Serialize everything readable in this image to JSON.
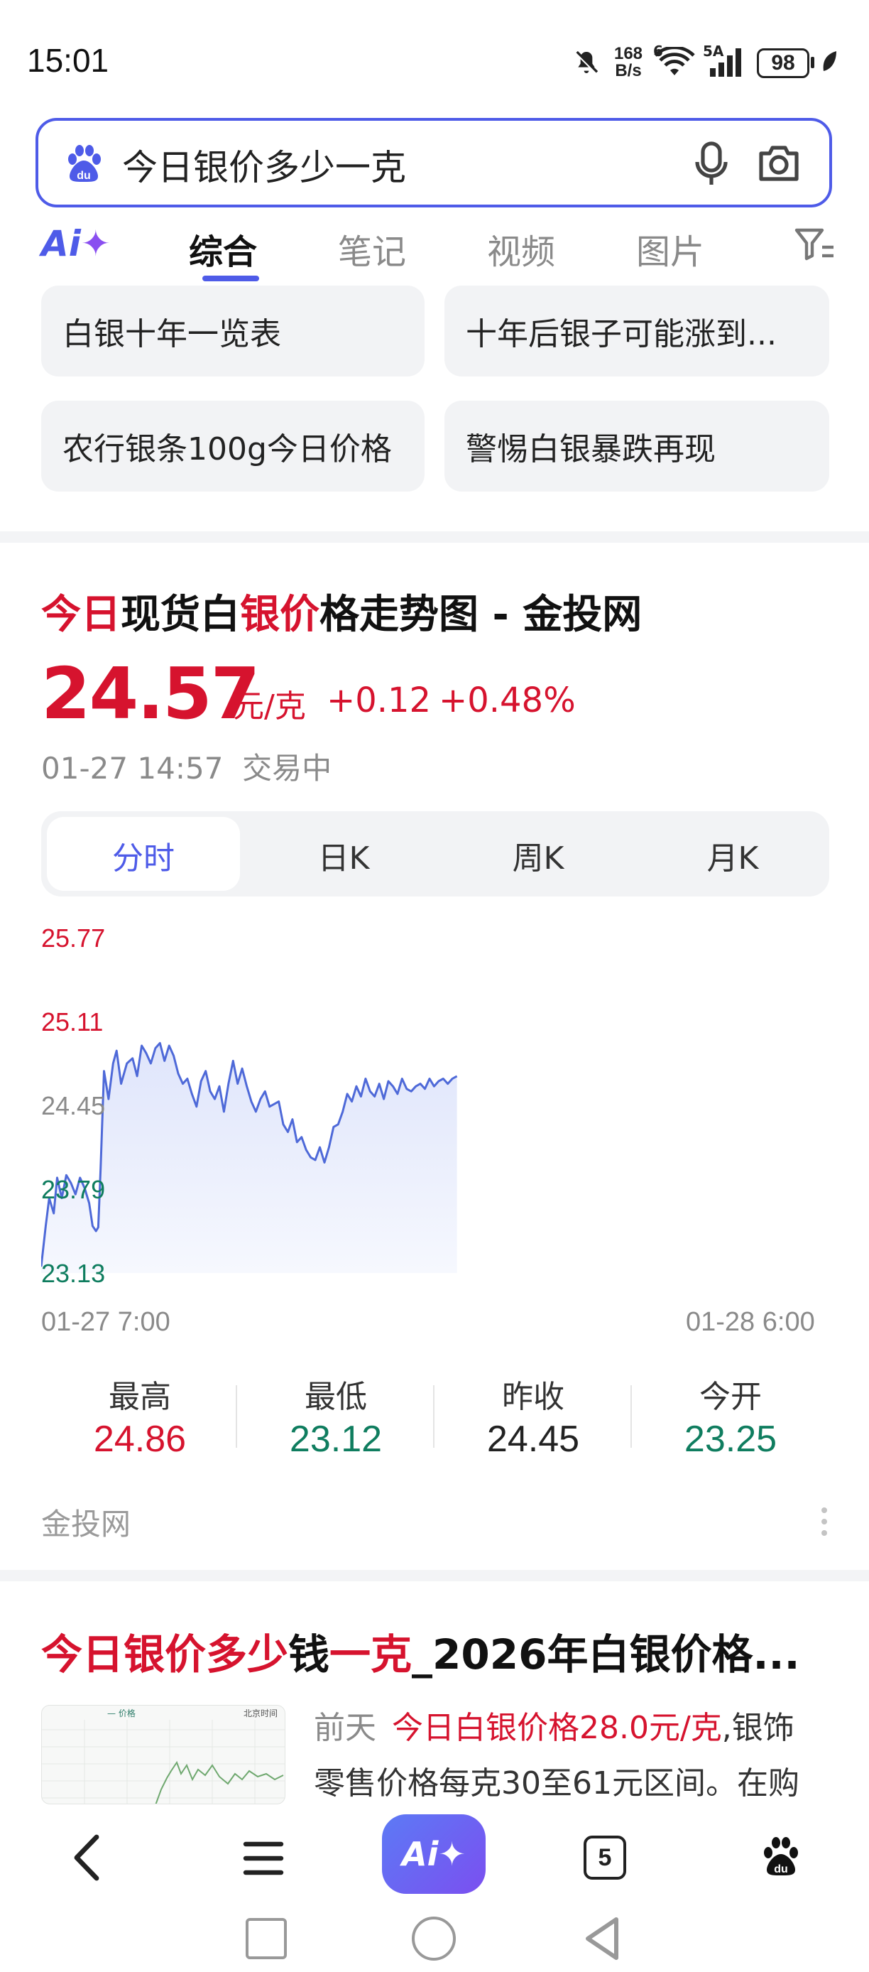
{
  "status_bar": {
    "time": "15:01",
    "net_speed_top": "168",
    "net_speed_bottom": "B/s",
    "wifi_badge": "6",
    "cell_badge": "5A",
    "battery": "98",
    "icons": [
      "bell-off-icon",
      "wifi-icon",
      "signal-icon",
      "battery-icon",
      "leaf-icon"
    ]
  },
  "search": {
    "query": "今日银价多少一克",
    "icons": [
      "baidu-paw-icon",
      "microphone-icon",
      "camera-icon"
    ]
  },
  "tabs": {
    "ai_label": "Ai",
    "items": [
      "综合",
      "笔记",
      "视频",
      "图片"
    ],
    "active": "综合",
    "filter_icon": "filter-icon"
  },
  "suggestions": [
    "白银十年一览表",
    "十年后银子可能涨到...",
    "农行银条100g今日价格",
    "警惕白银暴跌再现"
  ],
  "quote_card": {
    "title_parts": [
      {
        "text": "今日",
        "highlight": true
      },
      {
        "text": "现货白",
        "highlight": false
      },
      {
        "text": "银价",
        "highlight": true
      },
      {
        "text": "格走势图 - 金投网",
        "highlight": false
      }
    ],
    "price": "24.57",
    "unit": "元/克",
    "change": "+0.12",
    "change_pct": "+0.48%",
    "timestamp_status": "01-27 14:57  交易中",
    "period_tabs": [
      "分时",
      "日K",
      "周K",
      "月K"
    ],
    "active_period": "分时",
    "source": "金投网",
    "stats": [
      {
        "label": "最高",
        "value": "24.86",
        "color": "#d6132e"
      },
      {
        "label": "最低",
        "value": "23.12",
        "color": "#0f7d5f"
      },
      {
        "label": "昨收",
        "value": "24.45",
        "color": "#222222"
      },
      {
        "label": "今开",
        "value": "23.25",
        "color": "#0f7d5f"
      }
    ]
  },
  "chart_data": {
    "type": "area",
    "title": "",
    "xlabel": "",
    "ylabel": "",
    "x_tick_labels": [
      "01-27 7:00",
      "01-28 6:00"
    ],
    "y_tick_labels": [
      "25.77",
      "25.11",
      "24.45",
      "23.79",
      "23.13"
    ],
    "y_tick_colors": [
      "#d6132e",
      "#d6132e",
      "#8a8a8a",
      "#0f7d5f",
      "#0f7d5f"
    ],
    "ylim": [
      23.13,
      25.77
    ],
    "x_range_minutes": [
      0,
      1380
    ],
    "baseline": 24.45,
    "grid": false,
    "line_color": "#4e69d8",
    "series": [
      {
        "x": [
          0,
          8,
          14,
          22,
          28,
          36,
          44,
          52,
          60,
          68,
          76,
          84,
          90,
          96,
          100,
          104,
          110,
          118,
          126,
          132,
          140,
          150,
          160,
          168,
          176,
          184,
          192,
          200,
          208,
          216,
          224,
          232,
          240,
          248,
          256,
          264,
          272,
          280,
          288,
          296,
          304,
          312,
          320,
          328,
          336,
          344,
          352,
          360,
          368,
          376,
          384,
          392,
          400,
          408,
          416,
          424,
          432,
          440,
          448,
          456,
          464,
          472,
          480,
          488,
          496,
          504,
          512,
          520,
          528,
          536,
          544,
          552,
          560,
          568,
          576,
          584,
          592,
          600,
          608,
          616,
          624,
          632,
          640,
          648,
          656,
          664,
          672,
          680,
          688,
          696,
          704,
          712,
          720,
          728
        ],
        "y": [
          23.18,
          23.5,
          23.72,
          23.6,
          23.88,
          23.72,
          23.9,
          23.84,
          23.75,
          23.88,
          23.8,
          23.68,
          23.5,
          23.46,
          23.49,
          23.95,
          24.72,
          24.5,
          24.78,
          24.88,
          24.62,
          24.78,
          24.82,
          24.68,
          24.92,
          24.86,
          24.78,
          24.9,
          24.94,
          24.8,
          24.92,
          24.84,
          24.7,
          24.62,
          24.66,
          24.54,
          24.44,
          24.64,
          24.72,
          24.56,
          24.5,
          24.6,
          24.4,
          24.62,
          24.8,
          24.62,
          24.74,
          24.6,
          24.48,
          24.4,
          24.5,
          24.56,
          24.44,
          24.46,
          24.48,
          24.3,
          24.24,
          24.34,
          24.16,
          24.2,
          24.1,
          24.04,
          24.02,
          24.12,
          24.0,
          24.12,
          24.28,
          24.3,
          24.4,
          24.54,
          24.48,
          24.6,
          24.52,
          24.66,
          24.56,
          24.52,
          24.62,
          24.5,
          24.64,
          24.6,
          24.54,
          24.66,
          24.58,
          24.56,
          24.6,
          24.62,
          24.58,
          24.66,
          24.6,
          24.64,
          24.66,
          24.62,
          24.66,
          24.68
        ]
      }
    ]
  },
  "result2": {
    "title_parts": [
      {
        "text": "今日银价多少",
        "highlight": true
      },
      {
        "text": "钱",
        "highlight": false
      },
      {
        "text": "一克",
        "highlight": true
      },
      {
        "text": "_2026年白银价格...",
        "highlight": false
      }
    ],
    "thumb_label_left": "— 价格",
    "thumb_label_right": "北京时间",
    "snippet_prefix": "前天",
    "snippet_highlight": "今日白银价格28.0元/克",
    "snippet_rest_line1": ",银饰",
    "snippet_line2": "零售价格每克30至61元区间。在购"
  },
  "bottom_nav": {
    "ai_label": "Ai",
    "tab_count": "5",
    "icons": [
      "back-icon",
      "menu-icon",
      "ai-icon",
      "tabs-icon",
      "baidu-paw-icon"
    ]
  }
}
